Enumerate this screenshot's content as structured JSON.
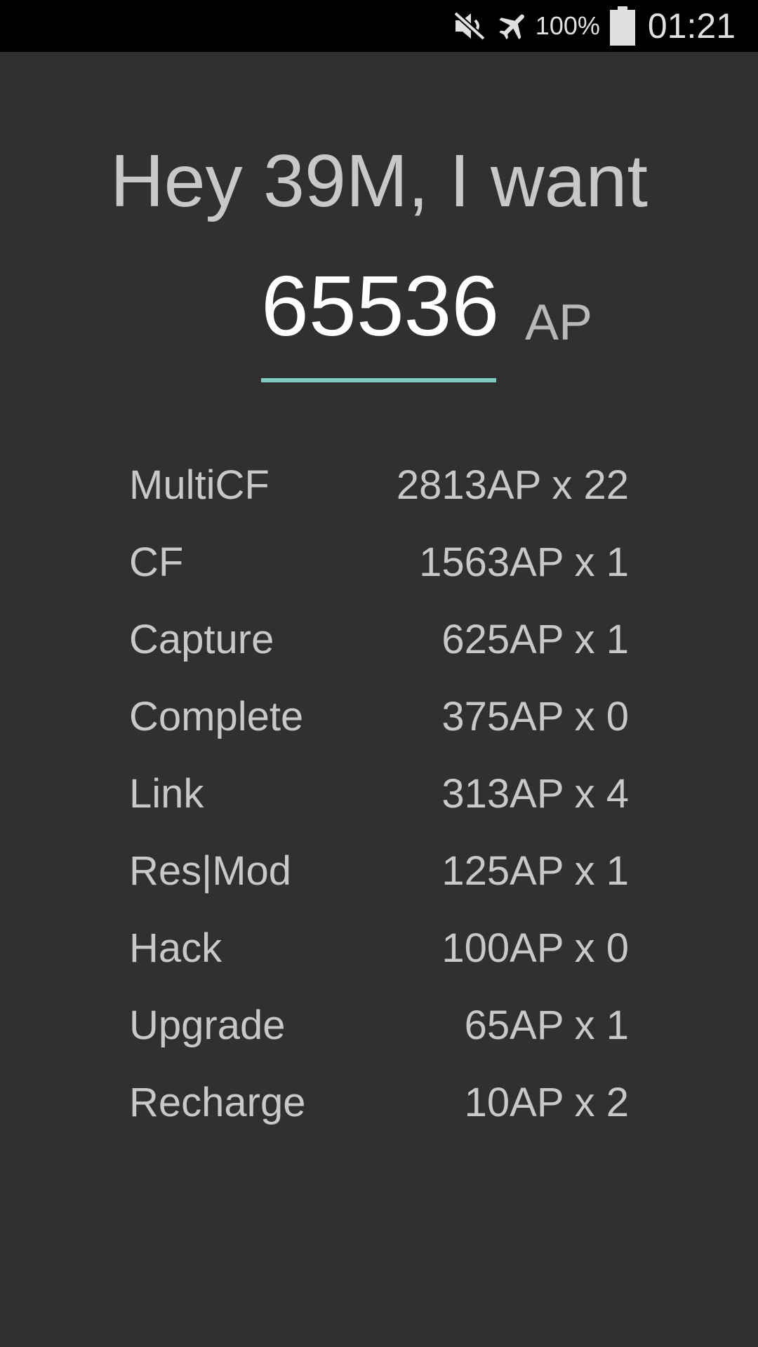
{
  "status_bar": {
    "icons": [
      "mute-icon",
      "airplane-mode-icon",
      "battery-icon"
    ],
    "battery_percent": "100%",
    "time": "01:21"
  },
  "greeting": "Hey 39M, I want",
  "target": {
    "value": "65536",
    "unit": "AP"
  },
  "colors": {
    "background": "#303030",
    "status_bar": "#000000",
    "accent": "#80cbc4",
    "text": "#c8c8c8"
  },
  "breakdown": [
    {
      "action": "MultiCF",
      "amount": "2813AP x 22"
    },
    {
      "action": "CF",
      "amount": "1563AP x 1"
    },
    {
      "action": "Capture",
      "amount": "625AP x 1"
    },
    {
      "action": "Complete",
      "amount": "375AP x 0"
    },
    {
      "action": "Link",
      "amount": "313AP x 4"
    },
    {
      "action": "Res|Mod",
      "amount": "125AP x 1"
    },
    {
      "action": "Hack",
      "amount": "100AP x 0"
    },
    {
      "action": "Upgrade",
      "amount": "65AP x 1"
    },
    {
      "action": "Recharge",
      "amount": "10AP x 2"
    }
  ]
}
